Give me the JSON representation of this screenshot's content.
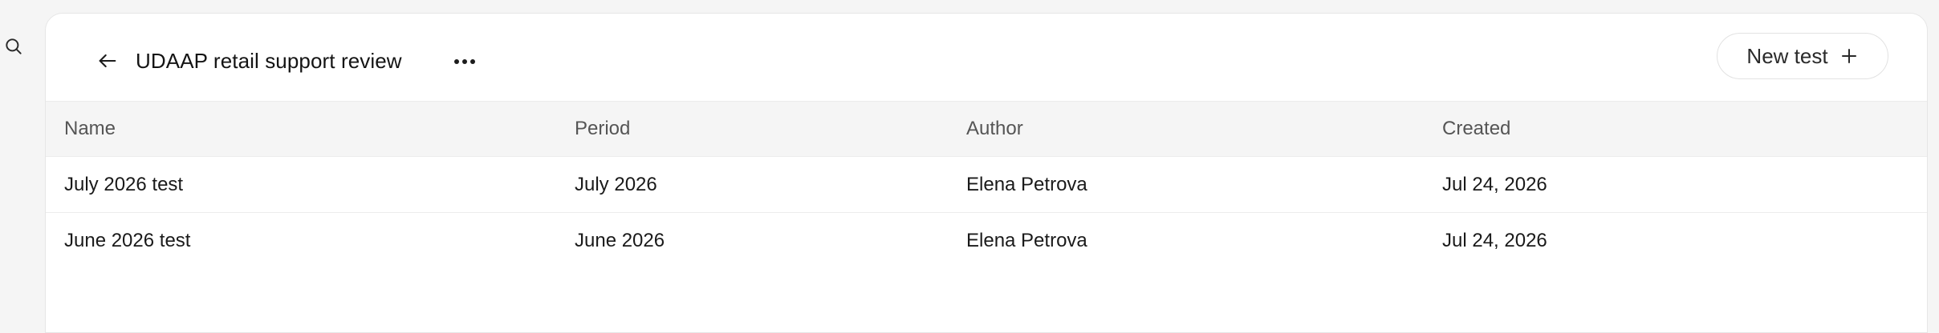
{
  "rail": {
    "search_icon": "search-icon"
  },
  "header": {
    "title": "UDAAP retail support review",
    "back_icon": "arrow-left-icon",
    "more_icon": "more-horizontal-icon",
    "new_button_label": "New test",
    "new_button_icon": "plus-icon"
  },
  "table": {
    "columns": [
      "Name",
      "Period",
      "Author",
      "Created"
    ],
    "rows": [
      {
        "name": "July 2026 test",
        "period": "July 2026",
        "author": "Elena Petrova",
        "created": "Jul 24, 2026"
      },
      {
        "name": "June 2026 test",
        "period": "June 2026",
        "author": "Elena Petrova",
        "created": "Jul 24, 2026"
      }
    ]
  },
  "colors": {
    "background": "#f5f5f5",
    "card": "#ffffff",
    "header_row": "#f5f5f5",
    "border": "#ececec",
    "text": "#1a1a1a",
    "muted_text": "#555555"
  }
}
